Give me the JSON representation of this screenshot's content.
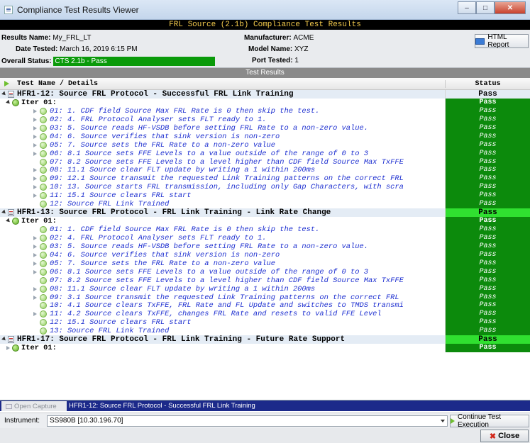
{
  "window": {
    "title": "Compliance Test Results Viewer"
  },
  "banner": "FRL Source (2.1b) Compliance Test Results",
  "info": {
    "results_name_label": "Results Name:",
    "results_name": "My_FRL_LT",
    "date_label": "Date Tested:",
    "date": "March 16, 2019 6:15 PM",
    "overall_label": "Overall Status:",
    "overall": "CTS 2.1b - Pass",
    "manufacturer_label": "Manufacturer:",
    "manufacturer": "ACME",
    "model_label": "Model Name:",
    "model": "XYZ",
    "port_label": "Port Tested:",
    "port": "1",
    "report_button": "HTML Report"
  },
  "results_header": "Test Results",
  "columns": {
    "name": "Test Name / Details",
    "status": "Status"
  },
  "rows": [
    {
      "kind": "test",
      "text": "HFR1-12: Source FRL Protocol - Successful FRL Link Training",
      "status": "Pass",
      "hl": false
    },
    {
      "kind": "iter",
      "text": "Iter 01:",
      "status": "Pass"
    },
    {
      "kind": "step",
      "exp": true,
      "text": "01: 1. CDF field Source Max FRL Rate is 0 then skip the test.",
      "status": "Pass"
    },
    {
      "kind": "step",
      "exp": true,
      "text": "02: 4. FRL Protocol Analyser sets FLT ready to 1.",
      "status": "Pass"
    },
    {
      "kind": "step",
      "exp": true,
      "text": "03: 5. Source reads HF-VSDB before setting FRL Rate to a non-zero value.",
      "status": "Pass"
    },
    {
      "kind": "step",
      "exp": true,
      "text": "04: 6. Source verifies that sink version is non-zero",
      "status": "Pass"
    },
    {
      "kind": "step",
      "exp": true,
      "text": "05: 7. Source sets the FRL Rate to a non-zero value",
      "status": "Pass"
    },
    {
      "kind": "step",
      "exp": true,
      "text": "06: 8.1 Source sets FFE Levels to a value outside of the range of 0 to 3",
      "status": "Pass"
    },
    {
      "kind": "step",
      "exp": false,
      "text": "07: 8.2 Source sets FFE Levels to a level higher than CDF field Source Max TxFFE",
      "status": "Pass"
    },
    {
      "kind": "step",
      "exp": true,
      "text": "08: 11.1 Source clear FLT update by writing a 1 within 200ms",
      "status": "Pass"
    },
    {
      "kind": "step",
      "exp": true,
      "text": "09: 12.1 Source transmit the requested Link Training patterns on the correct FRL",
      "status": "Pass"
    },
    {
      "kind": "step",
      "exp": true,
      "text": "10: 13. Source starts FRL transmission, including only Gap Characters, with scra",
      "status": "Pass"
    },
    {
      "kind": "step",
      "exp": true,
      "text": "11: 15.1 Source clears FRL start",
      "status": "Pass"
    },
    {
      "kind": "step",
      "exp": false,
      "text": "12: Source FRL Link Trained",
      "status": "Pass"
    },
    {
      "kind": "test",
      "text": "HFR1-13: Source FRL Protocol - FRL Link Training - Link Rate Change",
      "status": "Pass",
      "hl": true
    },
    {
      "kind": "iter",
      "text": "Iter 01:",
      "status": "Pass"
    },
    {
      "kind": "step",
      "exp": false,
      "text": "01: 1. CDF field Source Max FRL Rate is 0 then skip the test.",
      "status": "Pass"
    },
    {
      "kind": "step",
      "exp": true,
      "text": "02: 4. FRL Protocol Analyser sets FLT ready to 1.",
      "status": "Pass"
    },
    {
      "kind": "step",
      "exp": true,
      "text": "03: 5. Source reads HF-VSDB before setting FRL Rate to a non-zero value.",
      "status": "Pass"
    },
    {
      "kind": "step",
      "exp": true,
      "text": "04: 6. Source verifies that sink version is non-zero",
      "status": "Pass"
    },
    {
      "kind": "step",
      "exp": true,
      "text": "05: 7. Source sets the FRL Rate to a non-zero value",
      "status": "Pass"
    },
    {
      "kind": "step",
      "exp": true,
      "text": "06: 8.1 Source sets FFE Levels to a value outside of the range of 0 to 3",
      "status": "Pass"
    },
    {
      "kind": "step",
      "exp": false,
      "text": "07: 8.2 Source sets FFE Levels to a level higher than CDF field Source Max TxFFE",
      "status": "Pass"
    },
    {
      "kind": "step",
      "exp": true,
      "text": "08: 11.1 Source clear FLT update by writing a 1 within 200ms",
      "status": "Pass"
    },
    {
      "kind": "step",
      "exp": true,
      "text": "09: 3.1 Source transmit the requested Link Training patterns on the correct FRL",
      "status": "Pass"
    },
    {
      "kind": "step",
      "exp": false,
      "text": "10: 4.1 Source clears TxFFE, FRL Rate and FL Update and switches to TMDS transmi",
      "status": "Pass"
    },
    {
      "kind": "step",
      "exp": true,
      "text": "11: 4.2 Source clears TxFFE, changes FRL Rate and resets to valid FFE Level",
      "status": "Pass"
    },
    {
      "kind": "step",
      "exp": false,
      "text": "12: 15.1 Source clears FRL start",
      "status": "Pass"
    },
    {
      "kind": "step",
      "exp": false,
      "text": "13: Source FRL Link Trained",
      "status": "Pass"
    },
    {
      "kind": "test",
      "text": "HFR1-17: Source FRL Protocol - FRL Link Training - Future Rate Support",
      "status": "Pass",
      "hl": true
    },
    {
      "kind": "iter",
      "collapsed": true,
      "text": "Iter 01:",
      "status": "Pass"
    }
  ],
  "tabs": {
    "open_capture": "Open Capture",
    "current": "HFR1-12: Source FRL Protocol - Successful FRL Link Training"
  },
  "instrument": {
    "label": "Instrument:",
    "value": "SS980B [10.30.196.70]",
    "continue_button": "Continue Test Execution"
  },
  "close_button": "Close"
}
